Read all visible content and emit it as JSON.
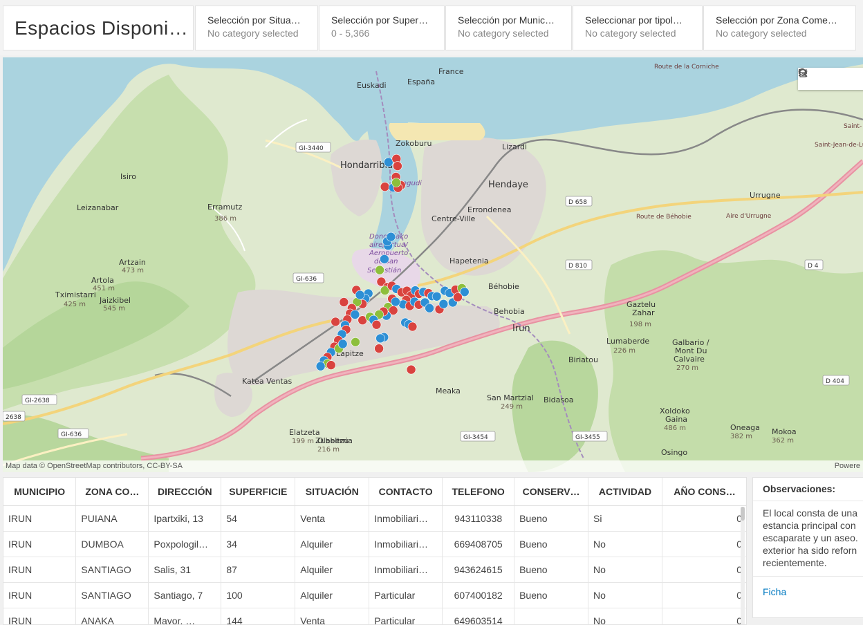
{
  "header": {
    "title": "Espacios Disponi…",
    "selectors": [
      {
        "title": "Selección por Situa…",
        "value": "No category selected"
      },
      {
        "title": "Selección por Super…",
        "value": "0 - 5,366"
      },
      {
        "title": "Selección por Munic…",
        "value": "No category selected"
      },
      {
        "title": "Seleccionar por tipol…",
        "value": "No category selected"
      },
      {
        "title": "Selección por Zona Come…",
        "value": "No category selected"
      }
    ]
  },
  "map": {
    "attribution": "Map data © OpenStreetMap contributors, CC-BY-SA",
    "powered": "Powere",
    "tools": [
      "search-icon",
      "home-icon",
      "legend-icon",
      "layers-icon"
    ],
    "labels": [
      {
        "text": "Zokoburu"
      },
      {
        "text": "Lizardi"
      },
      {
        "text": "Hendaye"
      },
      {
        "text": "Errondenea"
      },
      {
        "text": "Centre-Ville"
      },
      {
        "text": "Hapetenia"
      },
      {
        "text": "Béhobie"
      },
      {
        "text": "Behobia"
      },
      {
        "text": "Lapitze"
      },
      {
        "text": "Meaka"
      },
      {
        "text": "Bidasoa"
      },
      {
        "text": "Biriatou"
      },
      {
        "text": "Urrugne"
      },
      {
        "text": "Olaberria"
      },
      {
        "text": "Katea Ventas"
      },
      {
        "text": "Hondarribia"
      },
      {
        "text": "Isiro"
      },
      {
        "text": "Leizanabar"
      },
      {
        "text": "Erramutz"
      },
      {
        "text": "386 m"
      },
      {
        "text": "Artzain"
      },
      {
        "text": "473 m"
      },
      {
        "text": "Artola"
      },
      {
        "text": "451 m"
      },
      {
        "text": "Tximistarri"
      },
      {
        "text": "425 m"
      },
      {
        "text": "Jaizkibel"
      },
      {
        "text": "545 m"
      },
      {
        "text": "Gaztelu"
      },
      {
        "text": "Zahar"
      },
      {
        "text": "198 m"
      },
      {
        "text": "Lumaberde"
      },
      {
        "text": "226 m"
      },
      {
        "text": "Galbario /"
      },
      {
        "text": "Mont Du"
      },
      {
        "text": "Calvaire"
      },
      {
        "text": "270 m"
      },
      {
        "text": "Xoldoko"
      },
      {
        "text": "Gaina"
      },
      {
        "text": "486 m"
      },
      {
        "text": "San Martzial"
      },
      {
        "text": "249 m"
      },
      {
        "text": "Elatzeta"
      },
      {
        "text": "199 m"
      },
      {
        "text": "Zubeltzu"
      },
      {
        "text": "216 m"
      },
      {
        "text": "Oneaga"
      },
      {
        "text": "382 m"
      },
      {
        "text": "Mokoa"
      },
      {
        "text": "362 m"
      },
      {
        "text": "Osingo"
      },
      {
        "text": "Donostiako"
      },
      {
        "text": "aireportua/"
      },
      {
        "text": "Aeropuerto"
      },
      {
        "text": "de San"
      },
      {
        "text": "Sebastián"
      },
      {
        "text": "Txingudi"
      },
      {
        "text": "Saint-Jean-de-Lu"
      },
      {
        "text": "Saint-"
      },
      {
        "text": "Aire d'Urrugne"
      },
      {
        "text": "Route de Béhobie"
      },
      {
        "text": "Route de la Corniche"
      },
      {
        "text": "España"
      },
      {
        "text": "France"
      },
      {
        "text": "Euskadi"
      },
      {
        "text": "Irun"
      }
    ],
    "shields": [
      {
        "text": "GI-3440"
      },
      {
        "text": "GI-636"
      },
      {
        "text": "D 658"
      },
      {
        "text": "D 810"
      },
      {
        "text": "D 4"
      },
      {
        "text": "D 404"
      },
      {
        "text": "GI-3454"
      },
      {
        "text": "GI-3455"
      },
      {
        "text": "GI-2638"
      },
      {
        "text": "GI-636"
      },
      {
        "text": "2638"
      }
    ],
    "points": [
      {
        "lon": -1.7896,
        "lat": 43.3672,
        "type": "Alquiler"
      },
      {
        "lon": -1.7861,
        "lat": 43.3681,
        "type": "Venta"
      },
      {
        "lon": -1.7856,
        "lat": 43.3662,
        "type": "Venta"
      },
      {
        "lon": -1.7863,
        "lat": 43.3633,
        "type": "Venta"
      },
      {
        "lon": -1.7912,
        "lat": 43.3607,
        "type": "Venta"
      },
      {
        "lon": -1.7875,
        "lat": 43.3605,
        "type": "Alquiler"
      },
      {
        "lon": -1.7841,
        "lat": 43.3611,
        "type": "Venta"
      },
      {
        "lon": -1.7854,
        "lat": 43.3604,
        "type": "Venta"
      },
      {
        "lon": -1.7862,
        "lat": 43.3618,
        "type": "Otro"
      },
      {
        "lon": -1.7898,
        "lat": 43.3451,
        "type": "Alquiler"
      },
      {
        "lon": -1.7902,
        "lat": 43.3462,
        "type": "Alquiler"
      },
      {
        "lon": -1.7885,
        "lat": 43.3474,
        "type": "Alquiler"
      },
      {
        "lon": -1.7914,
        "lat": 43.3415,
        "type": "Alquiler"
      },
      {
        "lon": -1.7935,
        "lat": 43.3386,
        "type": "Otro"
      },
      {
        "lon": -1.8038,
        "lat": 43.3333,
        "type": "Venta"
      },
      {
        "lon": -1.7928,
        "lat": 43.3355,
        "type": "Venta"
      },
      {
        "lon": -1.7901,
        "lat": 43.3341,
        "type": "Venta"
      },
      {
        "lon": -1.7912,
        "lat": 43.3332,
        "type": "Otro"
      },
      {
        "lon": -1.7881,
        "lat": 43.3344,
        "type": "Venta"
      },
      {
        "lon": -1.7861,
        "lat": 43.3336,
        "type": "Alquiler"
      },
      {
        "lon": -1.7838,
        "lat": 43.3327,
        "type": "Venta"
      },
      {
        "lon": -1.7815,
        "lat": 43.3331,
        "type": "Venta"
      },
      {
        "lon": -1.7796,
        "lat": 43.3319,
        "type": "Venta"
      },
      {
        "lon": -1.7778,
        "lat": 43.3332,
        "type": "Alquiler"
      },
      {
        "lon": -1.7761,
        "lat": 43.3323,
        "type": "Venta"
      },
      {
        "lon": -1.7742,
        "lat": 43.3328,
        "type": "Alquiler"
      },
      {
        "lon": -1.772,
        "lat": 43.3325,
        "type": "Venta"
      },
      {
        "lon": -1.7704,
        "lat": 43.3317,
        "type": "Alquiler"
      },
      {
        "lon": -1.7683,
        "lat": 43.3316,
        "type": "Alquiler"
      },
      {
        "lon": -1.7647,
        "lat": 43.3331,
        "type": "Alquiler"
      },
      {
        "lon": -1.7626,
        "lat": 43.3325,
        "type": "Alquiler"
      },
      {
        "lon": -1.76,
        "lat": 43.3334,
        "type": "Venta"
      },
      {
        "lon": -1.7572,
        "lat": 43.3338,
        "type": "Otro"
      },
      {
        "lon": -1.756,
        "lat": 43.3328,
        "type": "Alquiler"
      },
      {
        "lon": -1.7818,
        "lat": 43.3307,
        "type": "Venta"
      },
      {
        "lon": -1.7831,
        "lat": 43.3295,
        "type": "Alquiler"
      },
      {
        "lon": -1.7802,
        "lat": 43.3291,
        "type": "Venta"
      },
      {
        "lon": -1.7781,
        "lat": 43.3302,
        "type": "Alquiler"
      },
      {
        "lon": -1.7762,
        "lat": 43.3294,
        "type": "Venta"
      },
      {
        "lon": -1.7735,
        "lat": 43.33,
        "type": "Alquiler"
      },
      {
        "lon": -1.7715,
        "lat": 43.3285,
        "type": "Alquiler"
      },
      {
        "lon": -1.788,
        "lat": 43.331,
        "type": "Venta"
      },
      {
        "lon": -1.7865,
        "lat": 43.3302,
        "type": "Alquiler"
      },
      {
        "lon": -1.7898,
        "lat": 43.3288,
        "type": "Otro"
      },
      {
        "lon": -1.7875,
        "lat": 43.3279,
        "type": "Venta"
      },
      {
        "lon": -1.7905,
        "lat": 43.3265,
        "type": "Alquiler"
      },
      {
        "lon": -1.7918,
        "lat": 43.3276,
        "type": "Venta"
      },
      {
        "lon": -1.7938,
        "lat": 43.3268,
        "type": "Otro"
      },
      {
        "lon": -1.7985,
        "lat": 43.3324,
        "type": "Alquiler"
      },
      {
        "lon": -1.7999,
        "lat": 43.331,
        "type": "Alquiler"
      },
      {
        "lon": -1.8011,
        "lat": 43.3296,
        "type": "Venta"
      },
      {
        "lon": -1.8035,
        "lat": 43.3301,
        "type": "Otro"
      },
      {
        "lon": -1.8022,
        "lat": 43.332,
        "type": "Alquiler"
      },
      {
        "lon": -1.8058,
        "lat": 43.3285,
        "type": "Venta"
      },
      {
        "lon": -1.8066,
        "lat": 43.3271,
        "type": "Venta"
      },
      {
        "lon": -1.8044,
        "lat": 43.3268,
        "type": "Alquiler"
      },
      {
        "lon": -1.8078,
        "lat": 43.3255,
        "type": "Venta"
      },
      {
        "lon": -1.8088,
        "lat": 43.324,
        "type": "Alquiler"
      },
      {
        "lon": -1.8011,
        "lat": 43.3253,
        "type": "Venta"
      },
      {
        "lon": -1.7978,
        "lat": 43.3262,
        "type": "Otro"
      },
      {
        "lon": -1.7962,
        "lat": 43.3254,
        "type": "Alquiler"
      },
      {
        "lon": -1.7949,
        "lat": 43.3241,
        "type": "Venta"
      },
      {
        "lon": -1.7822,
        "lat": 43.3247,
        "type": "Alquiler"
      },
      {
        "lon": -1.7806,
        "lat": 43.3242,
        "type": "Alquiler"
      },
      {
        "lon": -1.779,
        "lat": 43.3236,
        "type": "Venta"
      },
      {
        "lon": -1.7916,
        "lat": 43.3208,
        "type": "Alquiler"
      },
      {
        "lon": -1.7932,
        "lat": 43.3205,
        "type": "Alquiler"
      },
      {
        "lon": -1.7938,
        "lat": 43.3178,
        "type": "Venta"
      },
      {
        "lon": -1.8042,
        "lat": 43.3195,
        "type": "Otro"
      },
      {
        "lon": -1.8083,
        "lat": 43.3228,
        "type": "Venta"
      },
      {
        "lon": -1.8102,
        "lat": 43.3216,
        "type": "Alquiler"
      },
      {
        "lon": -1.8118,
        "lat": 43.32,
        "type": "Venta"
      },
      {
        "lon": -1.8135,
        "lat": 43.3183,
        "type": "Venta"
      },
      {
        "lon": -1.815,
        "lat": 43.3168,
        "type": "Alquiler"
      },
      {
        "lon": -1.8166,
        "lat": 43.3155,
        "type": "Venta"
      },
      {
        "lon": -1.8181,
        "lat": 43.3146,
        "type": "Alquiler"
      },
      {
        "lon": -1.8165,
        "lat": 43.3138,
        "type": "Otro"
      },
      {
        "lon": -1.815,
        "lat": 43.3134,
        "type": "Venta"
      },
      {
        "lon": -1.8196,
        "lat": 43.3131,
        "type": "Alquiler"
      },
      {
        "lon": -1.8115,
        "lat": 43.3178,
        "type": "Otro"
      },
      {
        "lon": -1.8098,
        "lat": 43.319,
        "type": "Alquiler"
      },
      {
        "lon": -1.7796,
        "lat": 43.3122,
        "type": "Venta"
      },
      {
        "lon": -1.813,
        "lat": 43.3249,
        "type": "Venta"
      },
      {
        "lon": -1.8093,
        "lat": 43.3301,
        "type": "Venta"
      },
      {
        "lon": -1.7612,
        "lat": 43.33,
        "type": "Alquiler"
      },
      {
        "lon": -1.759,
        "lat": 43.3314,
        "type": "Venta"
      },
      {
        "lon": -1.7671,
        "lat": 43.3282,
        "type": "Venta"
      },
      {
        "lon": -1.7653,
        "lat": 43.3296,
        "type": "Alquiler"
      }
    ]
  },
  "table": {
    "columns": [
      "MUNICIPIO",
      "ZONA CO…",
      "DIRECCIÓN",
      "SUPERFICIE",
      "SITUACIÓN",
      "CONTACTO",
      "TELEFONO",
      "CONSERV…",
      "ACTIVIDAD",
      "AÑO CONS…"
    ],
    "rows": [
      [
        "IRUN",
        "PUIANA",
        "Ipartxiki, 13",
        "54",
        "Venta",
        "Inmobiliari…",
        "943110338",
        "Bueno",
        "Si",
        "0"
      ],
      [
        "IRUN",
        "DUMBOA",
        "Poxpologil…",
        "34",
        "Alquiler",
        "Inmobiliari…",
        "669408705",
        "Bueno",
        "No",
        "0"
      ],
      [
        "IRUN",
        "SANTIAGO",
        "Salis, 31",
        "87",
        "Alquiler",
        "Inmobiliari…",
        "943624615",
        "Bueno",
        "No",
        "0"
      ],
      [
        "IRUN",
        "SANTIAGO",
        "Santiago, 7",
        "100",
        "Alquiler",
        "Particular",
        "607400182",
        "Bueno",
        "No",
        "0"
      ],
      [
        "IRUN",
        "ANAKA",
        "Mayor, …",
        "144",
        "Venta",
        "Particular",
        "649603514",
        "",
        "No",
        "0"
      ]
    ]
  },
  "observations": {
    "title": "Observaciones:",
    "text": "El local consta de una\nestancia principal con\nescaparate y un aseo.\nexterior ha sido reforn\nrecientemente.",
    "link": "Ficha"
  },
  "colors": {
    "venta": "#d9433f",
    "alquiler": "#2d8fd5",
    "otro": "#8dbf3c"
  }
}
